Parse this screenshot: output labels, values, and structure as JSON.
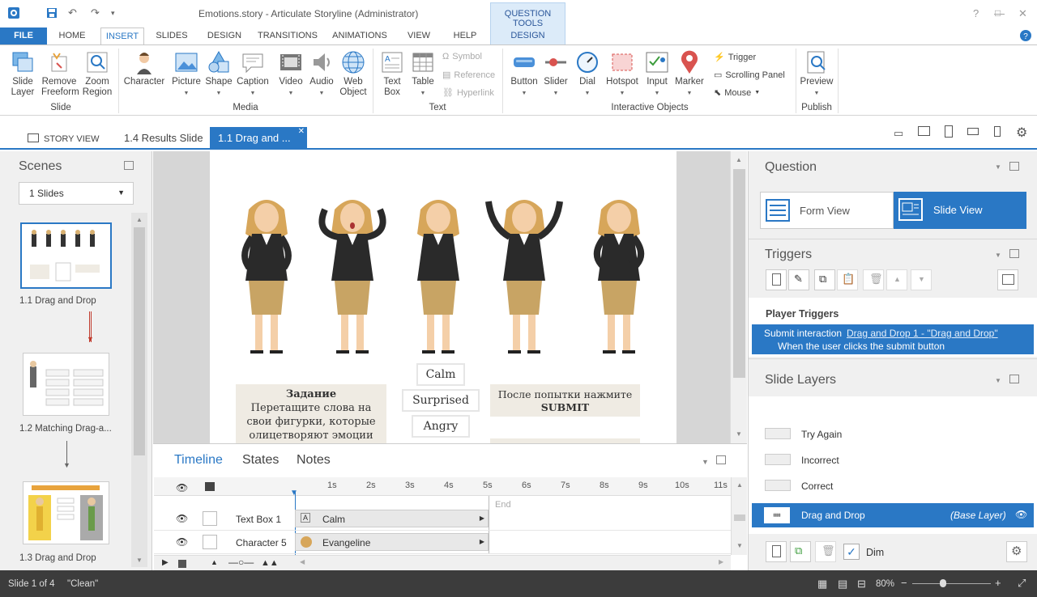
{
  "window": {
    "title": "Emotions.story - Articulate Storyline (Administrator)",
    "context_tab_group": "QUESTION TOOLS"
  },
  "ribbon_tabs": [
    "FILE",
    "HOME",
    "INSERT",
    "SLIDES",
    "DESIGN",
    "TRANSITIONS",
    "ANIMATIONS",
    "VIEW",
    "HELP",
    "DESIGN"
  ],
  "ribbon": {
    "slide_group": {
      "label": "Slide",
      "items": [
        "Slide Layer",
        "Remove Freeform",
        "Zoom Region"
      ]
    },
    "media_group": {
      "label": "Media",
      "items": [
        "Character",
        "Picture",
        "Shape",
        "Caption",
        "Video",
        "Audio",
        "Web Object"
      ]
    },
    "text_group": {
      "label": "Text",
      "items": [
        "Text Box",
        "Table"
      ],
      "small": [
        "Symbol",
        "Reference",
        "Hyperlink"
      ]
    },
    "interactive_group": {
      "label": "Interactive Objects",
      "items": [
        "Button",
        "Slider",
        "Dial",
        "Hotspot",
        "Input",
        "Marker"
      ],
      "small": [
        "Trigger",
        "Scrolling Panel",
        "Mouse"
      ]
    },
    "publish_group": {
      "label": "Publish",
      "items": [
        "Preview"
      ]
    }
  },
  "doc_tabs": {
    "story_view": "STORY VIEW",
    "tab1": "1.4 Results Slide",
    "tab2": "1.1 Drag and ..."
  },
  "scenes": {
    "title": "Scenes",
    "dropdown": "1 Slides",
    "slides": [
      {
        "label": "1.1 Drag and Drop"
      },
      {
        "label": "1.2 Matching Drag-a..."
      },
      {
        "label": "1.3 Drag and Drop"
      }
    ]
  },
  "slide": {
    "task_title": "Задание",
    "task_text": "Перетащите слова на свои фигурки, которые олицетворяют эмоции",
    "words": [
      "Calm",
      "Surprised",
      "Angry"
    ],
    "submit_note": "После попытки нажмите",
    "submit_word": "SUBMIT"
  },
  "timeline": {
    "tabs": [
      "Timeline",
      "States",
      "Notes"
    ],
    "ticks": [
      "1s",
      "2s",
      "3s",
      "4s",
      "5s",
      "6s",
      "7s",
      "8s",
      "9s",
      "10s",
      "11s"
    ],
    "end_label": "End",
    "rows": [
      {
        "name": "Text Box 1",
        "object": "Calm"
      },
      {
        "name": "Character 5",
        "object": "Evangeline"
      }
    ]
  },
  "question": {
    "title": "Question",
    "form_view": "Form View",
    "slide_view": "Slide View"
  },
  "triggers": {
    "title": "Triggers",
    "player_triggers": "Player Triggers",
    "trigger_action": "Submit interaction",
    "trigger_link": "Drag and Drop 1 - \"Drag and Drop\"",
    "trigger_condition": "When the user clicks the submit button"
  },
  "slide_layers": {
    "title": "Slide Layers",
    "layers": [
      "Try Again",
      "Incorrect",
      "Correct"
    ],
    "base": {
      "name": "Drag and Drop",
      "tag": "(Base Layer)"
    },
    "dim_label": "Dim"
  },
  "status": {
    "slide": "Slide 1 of 4",
    "theme": "\"Clean\"",
    "zoom": "80%"
  },
  "colors": {
    "accent": "#2a78c5",
    "ribbon_context": "#dcebf9"
  }
}
